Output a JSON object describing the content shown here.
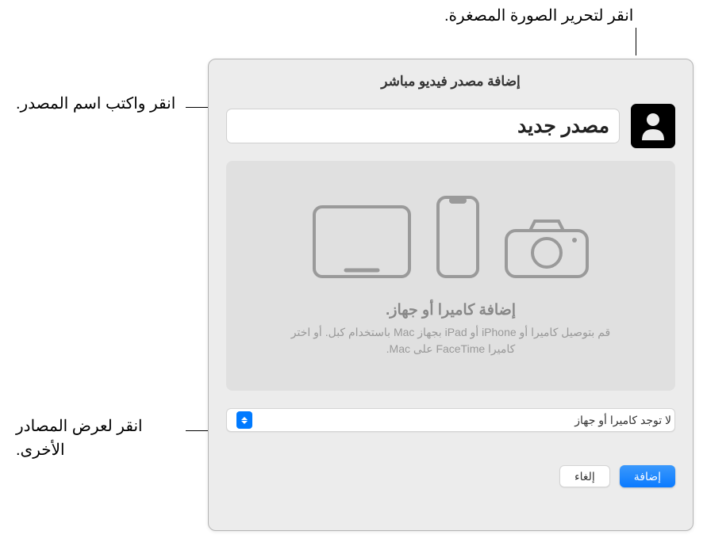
{
  "callouts": {
    "thumbnail": "انقر لتحرير الصورة المصغرة.",
    "name": "انقر واكتب اسم المصدر.",
    "sources": "انقر لعرض المصادر الأخرى."
  },
  "window": {
    "title": "إضافة مصدر فيديو مباشر"
  },
  "source": {
    "name_value": "مصدر جديد"
  },
  "device_area": {
    "heading": "إضافة كاميرا أو جهاز.",
    "subtext": "قم بتوصيل كاميرا أو iPhone أو iPad بجهاز Mac باستخدام كبل. أو اختر كاميرا FaceTime على Mac."
  },
  "dropdown": {
    "selected": "لا توجد كاميرا أو جهاز"
  },
  "buttons": {
    "add": "إضافة",
    "cancel": "إلغاء"
  }
}
